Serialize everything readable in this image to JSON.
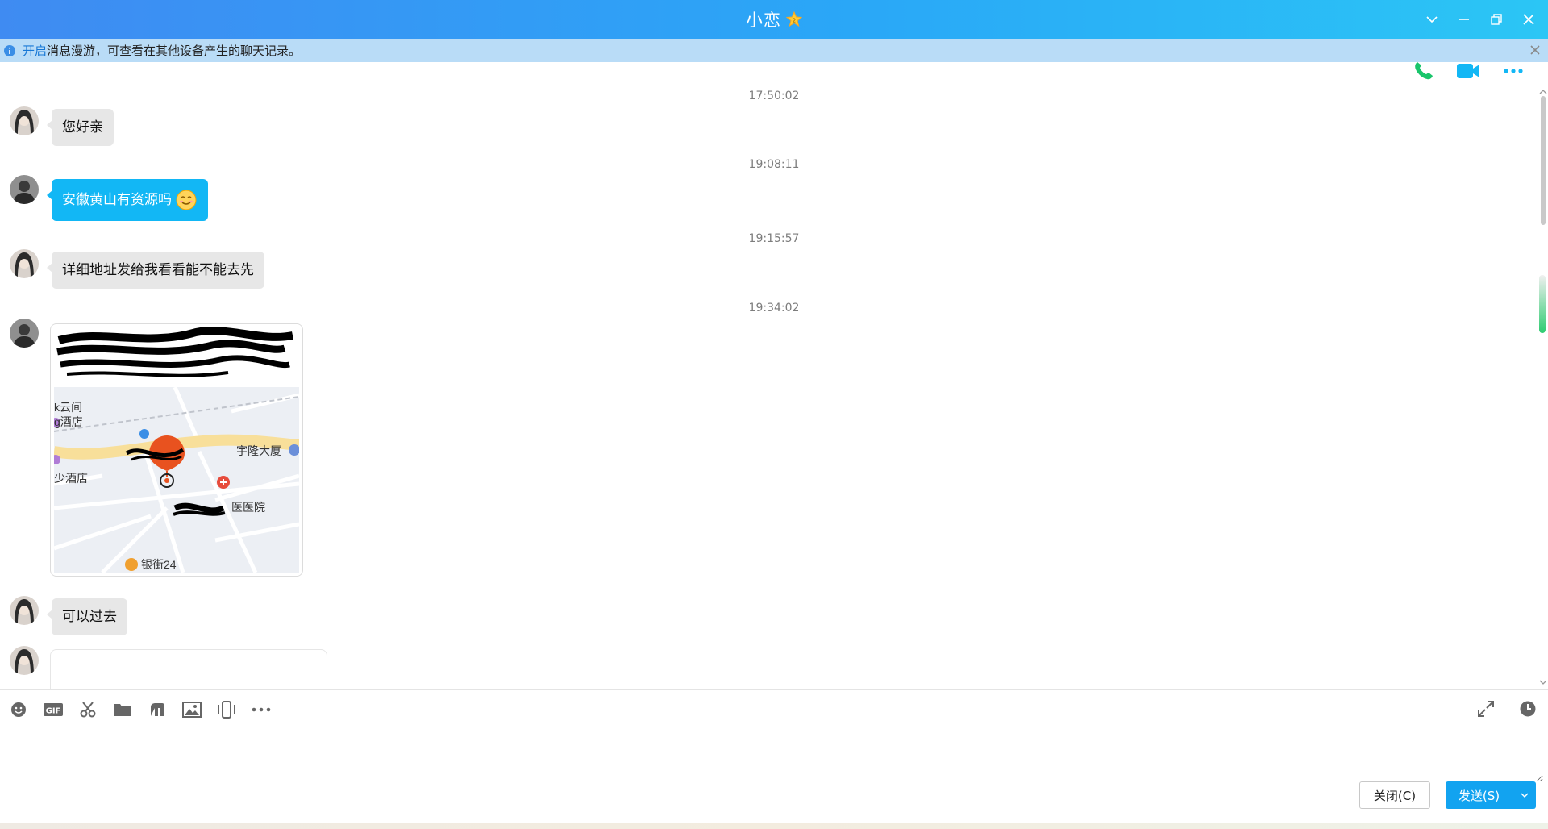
{
  "window": {
    "title": "小恋",
    "badge_icon": "vip-star-icon",
    "controls": [
      "chevron-down-icon",
      "minimize-icon",
      "restore-icon",
      "close-icon"
    ]
  },
  "notice": {
    "link_text": "开启",
    "text": "消息漫游，可查看在其他设备产生的聊天记录。"
  },
  "top_actions": [
    "voice-call-icon",
    "video-call-icon",
    "more-icon"
  ],
  "messages": [
    {
      "time": "17:50:02",
      "sender": "contact",
      "text": "您好亲"
    },
    {
      "time": "19:08:11",
      "sender": "self",
      "text": "安徽黄山有资源吗",
      "emoji": "smile-emoji"
    },
    {
      "time": "19:15:57",
      "sender": "contact",
      "text": "详细地址发给我看看能不能去先"
    },
    {
      "time": "19:34:02",
      "sender": "self",
      "type": "location",
      "map_labels": {
        "poi_1": "k云间",
        "poi_1b": "g酒店",
        "poi_2": "宇隆大厦",
        "poi_3": "少酒店",
        "poi_4": "医医院",
        "poi_5": "银街24"
      }
    },
    {
      "sender": "contact",
      "text": "可以过去"
    }
  ],
  "toolbar": {
    "left": [
      "emoji-icon",
      "gif-icon",
      "scissors-icon",
      "folder-icon",
      "quote-icon",
      "image-icon",
      "phone-shake-icon",
      "more-icon"
    ],
    "right": [
      "expand-icon",
      "history-clock-icon"
    ]
  },
  "input": {
    "placeholder": ""
  },
  "buttons": {
    "close_label": "关闭(C)",
    "send_label": "发送(S)"
  },
  "colors": {
    "accent": "#12b7f5",
    "send_button": "#12a3f0",
    "titlebar_start": "#3f8bf2",
    "titlebar_end": "#2bc6f5"
  }
}
